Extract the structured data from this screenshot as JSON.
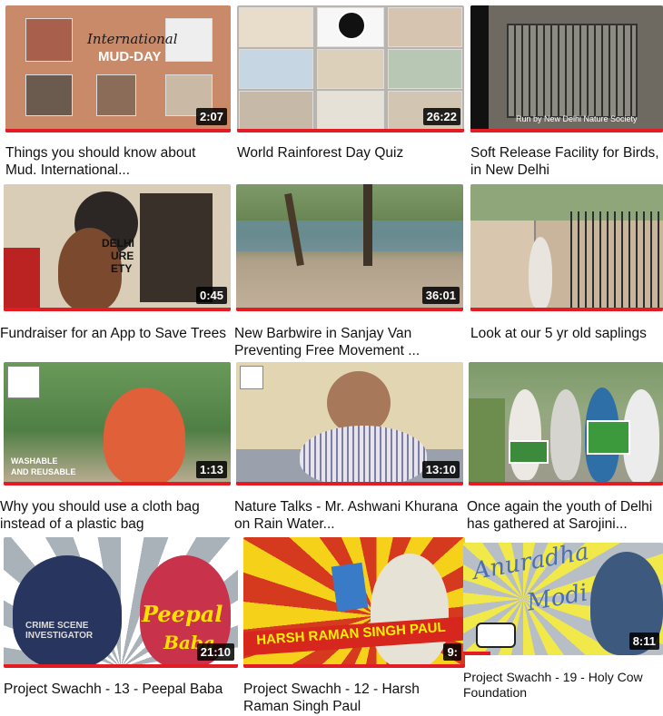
{
  "videos": [
    {
      "title": "Things you should know about Mud. International...",
      "duration": "2:07",
      "thumb_text": [
        "International",
        "MUD-DAY"
      ]
    },
    {
      "title": "World Rainforest Day Quiz",
      "duration": "26:22"
    },
    {
      "title": "Soft Release Facility for Birds, in New Delhi",
      "duration": "",
      "thumb_text": [
        "Run by New Delhi Nature Society"
      ]
    },
    {
      "title": "Fundraiser for an App to Save Trees",
      "duration": "0:45",
      "thumb_text": [
        "DELHI",
        "URE",
        "ETY"
      ]
    },
    {
      "title": "New Barbwire in Sanjay Van Preventing Free Movement ...",
      "duration": "36:01"
    },
    {
      "title": "Look at our 5 yr old saplings",
      "duration": ""
    },
    {
      "title": "Why you should use a cloth bag instead of a plastic bag",
      "duration": "1:13",
      "thumb_text": [
        "WASHABLE",
        "AND REUSABLE"
      ]
    },
    {
      "title": "Nature Talks - Mr. Ashwani Khurana on Rain Water...",
      "duration": "13:10"
    },
    {
      "title": "Once again the youth of Delhi has gathered at Sarojini...",
      "duration": ""
    },
    {
      "title": "Project Swachh - 13 - Peepal Baba",
      "duration": "21:10",
      "thumb_text": [
        "CRIME SCENE INVESTIGATOR",
        "Peepal",
        "Baba"
      ]
    },
    {
      "title": "Project Swachh - 12 - Harsh Raman Singh Paul",
      "duration": "9:",
      "thumb_text": [
        "HARSH RAMAN SINGH PAUL"
      ]
    },
    {
      "title": "Project Swachh - 19 - Holy Cow Foundation",
      "duration": "8:11",
      "thumb_text": [
        "Anuradha",
        "Modi"
      ]
    }
  ]
}
